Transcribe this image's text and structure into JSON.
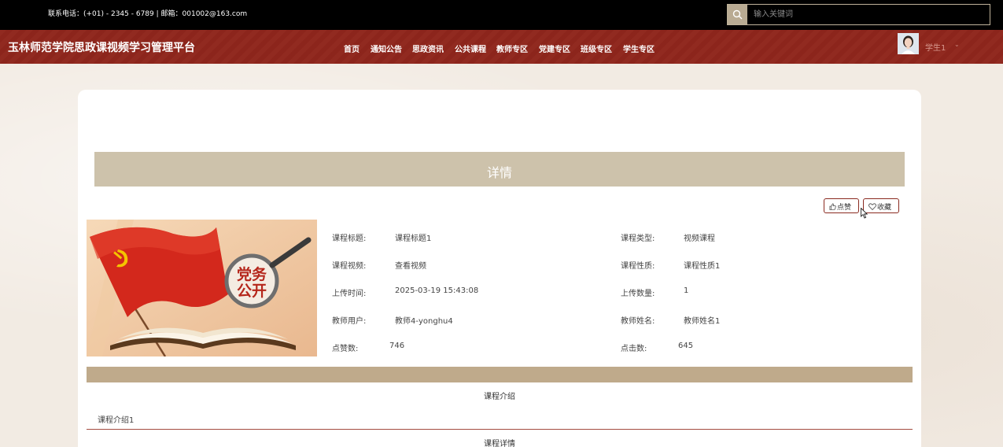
{
  "topbar": {
    "contact": "联系电话：(+01) - 2345 - 6789 | 邮箱：001002@163.com",
    "search_placeholder": "输入关键词"
  },
  "nav": {
    "site_title": "玉林师范学院思政课视频学习管理平台",
    "items": [
      "首页",
      "通知公告",
      "思政资讯",
      "公共课程",
      "教师专区",
      "党建专区",
      "班级专区",
      "学生专区"
    ],
    "user_name": "学生1",
    "caret": "⌄"
  },
  "detail": {
    "header": "详情",
    "like_label": "点赞",
    "favorite_label": "收藏",
    "cover_text": "党务公开",
    "fields": {
      "course_title_label": "课程标题:",
      "course_title": "课程标题1",
      "course_type_label": "课程类型:",
      "course_type": "视频课程",
      "course_video_label": "课程视频:",
      "course_video": "查看视频",
      "course_nature_label": "课程性质:",
      "course_nature": "课程性质1",
      "upload_time_label": "上传时间:",
      "upload_time": "2025-03-19 15:43:08",
      "upload_count_label": "上传数量:",
      "upload_count": "1",
      "teacher_user_label": "教师用户:",
      "teacher_user": "教师4-yonghu4",
      "teacher_name_label": "教师姓名:",
      "teacher_name": "教师姓名1",
      "likes_label": "点赞数:",
      "likes": "746",
      "clicks_label": "点击数:",
      "clicks": "645"
    },
    "intro_title": "课程介绍",
    "intro_text": "课程介绍1",
    "details_title": "课程详情"
  },
  "colors": {
    "nav_bg": "#8f261c",
    "header_bg": "#cdc2ab",
    "accent": "#8a2a20"
  }
}
